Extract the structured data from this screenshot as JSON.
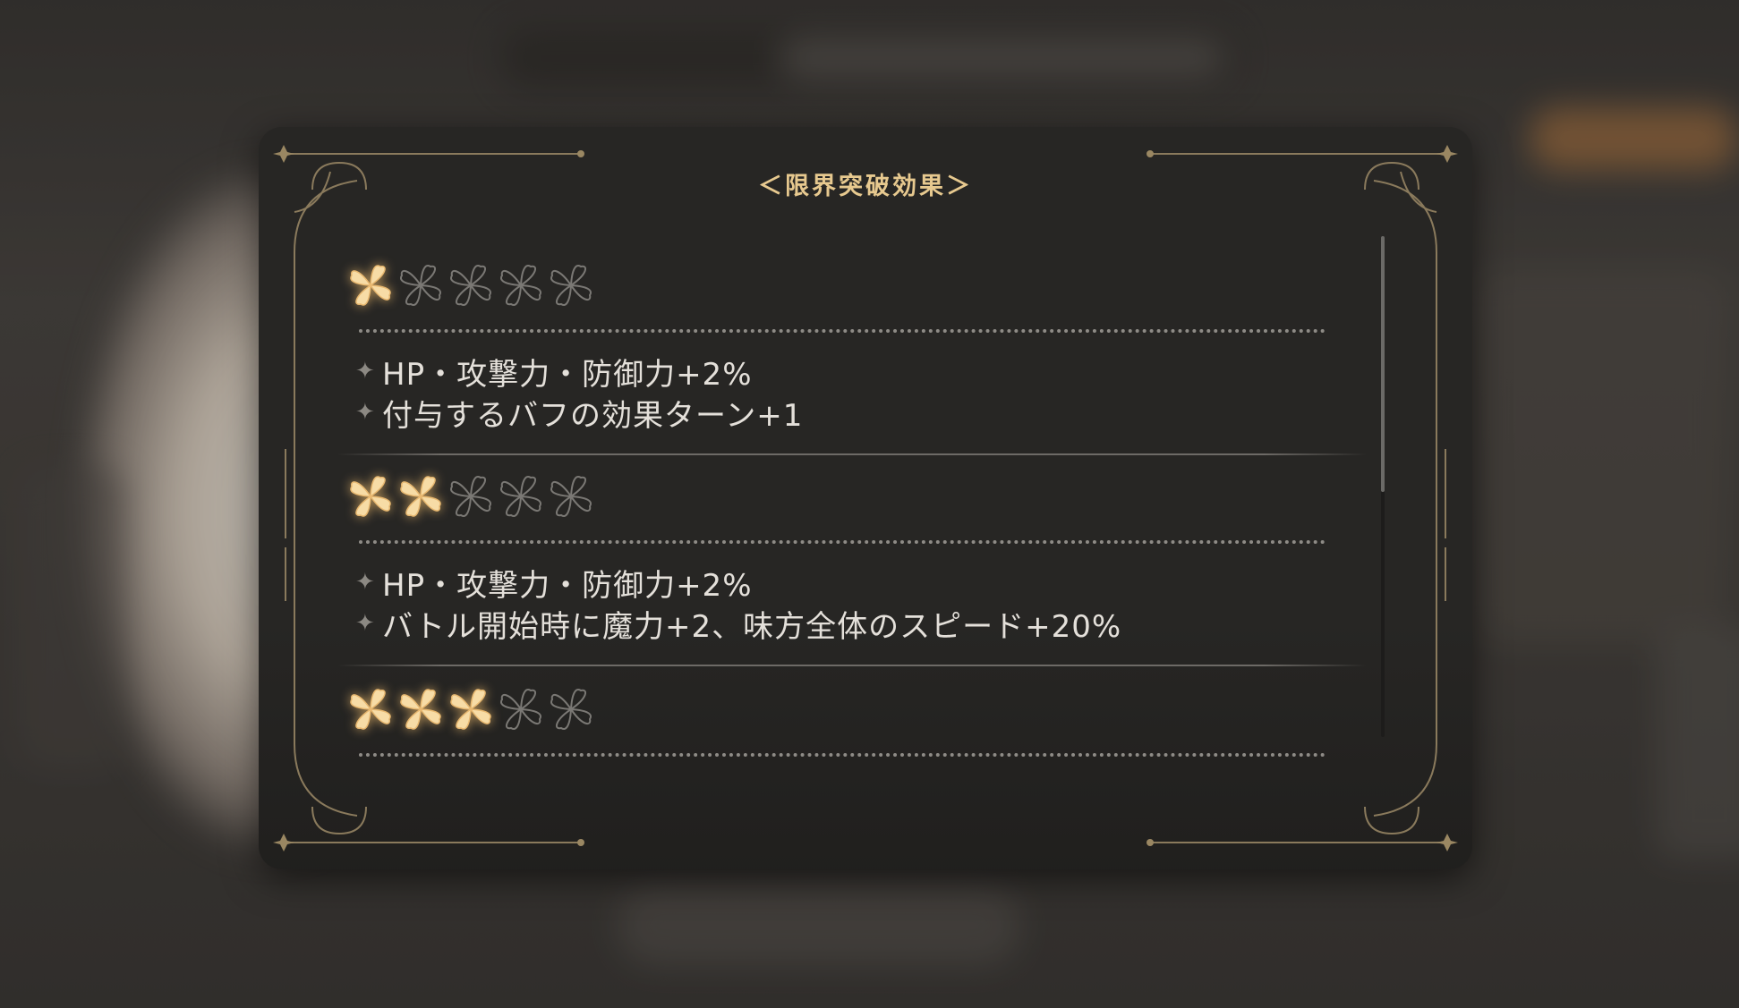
{
  "dialog": {
    "title": "＜限界突破効果＞"
  },
  "tiers": [
    {
      "filled_stars": 1,
      "total_stars": 5,
      "effects": [
        "HP・攻撃力・防御力+2%",
        "付与するバフの効果ターン+1"
      ]
    },
    {
      "filled_stars": 2,
      "total_stars": 5,
      "effects": [
        "HP・攻撃力・防御力+2%",
        "バトル開始時に魔力+2、味方全体のスピード+20%"
      ]
    },
    {
      "filled_stars": 3,
      "total_stars": 5,
      "effects": []
    }
  ],
  "colors": {
    "accent_gold": "#e7c98f",
    "panel_bg": "#272624",
    "text": "#e4e0da",
    "empty_star": "#7a7874"
  },
  "icons": {
    "bullet": "✦",
    "star": "limit-break-clover-icon"
  },
  "scrollbar": {
    "thumb_fraction": 0.51,
    "position_fraction": 0
  }
}
